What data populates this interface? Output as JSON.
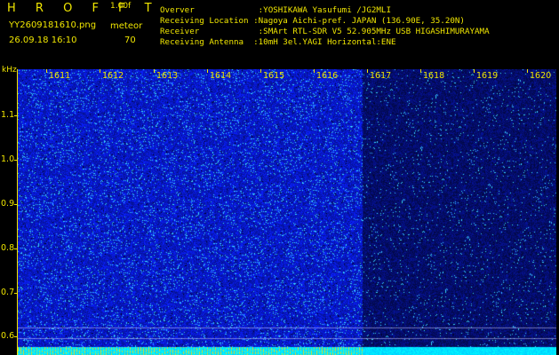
{
  "header": {
    "logo": "H R O F F T",
    "version": "1.00f",
    "filename": "YY2609181610.png",
    "datetime": "26.09.18 16:10",
    "mode": "meteor",
    "count": "70"
  },
  "station": {
    "lines": [
      "Overver             :YOSHIKAWA Yasufumi /JG2MLI",
      "Receiving Location :Nagoya Aichi-pref. JAPAN (136.90E, 35.20N)",
      "Receiver            :SMArt RTL-SDR V5 52.905MHz USB HIGASHIMURAYAMA",
      "Receiving Antenna  :10mH 3el.YAGI Horizontal:ENE"
    ]
  },
  "axes": {
    "y_unit": "kHz",
    "y_ticks": [
      "1.1",
      "1.0",
      "0.9",
      "0.8",
      "0.7",
      "0.6"
    ],
    "x_ticks": [
      "1611",
      "1612",
      "1613",
      "1614",
      "1615",
      "1616",
      "1617",
      "1618",
      "1619",
      "1620"
    ]
  },
  "colors": {
    "text": "#f0e600",
    "background": "#000000",
    "noise_bright": "#1a2ed8",
    "noise_dim": "#0a1470",
    "speckle": "#5fd8ff",
    "baseline": "#00e8ff"
  }
}
